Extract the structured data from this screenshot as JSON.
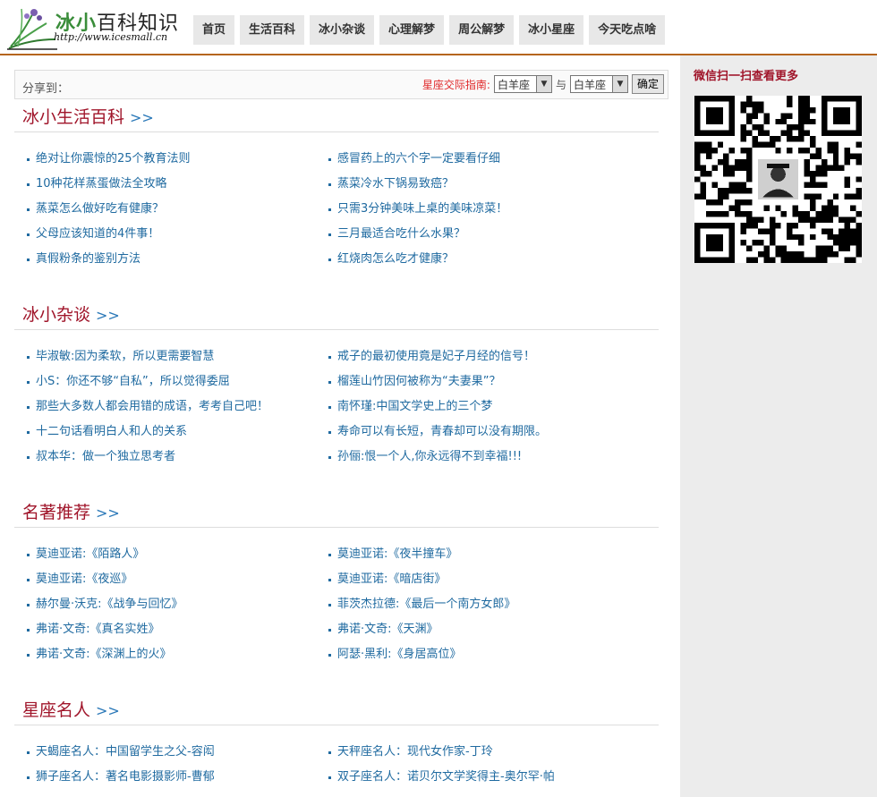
{
  "logo": {
    "name_a": "冰小",
    "name_b": "百科知识",
    "url": "http://www.icesmall.cn"
  },
  "nav": [
    "首页",
    "生活百科",
    "冰小杂谈",
    "心理解梦",
    "周公解梦",
    "冰小星座",
    "今天吃点啥"
  ],
  "share": {
    "label": "分享到：",
    "guide_label": "星座交际指南:",
    "select_a": "白羊座",
    "with": "与",
    "select_b": "白羊座",
    "confirm": "确定"
  },
  "sections": [
    {
      "title": "冰小生活百科",
      "more": ">>",
      "left": [
        "绝对让你震惊的25个教育法则",
        "10种花样蒸蛋做法全攻略",
        "蒸菜怎么做好吃有健康？",
        "父母应该知道的4件事！",
        "真假粉条的鉴别方法"
      ],
      "right": [
        "感冒药上的六个字一定要看仔细",
        "蒸菜冷水下锅易致癌？",
        "只需3分钟美味上桌的美味凉菜！",
        "三月最适合吃什么水果？",
        "红烧肉怎么吃才健康？"
      ]
    },
    {
      "title": "冰小杂谈",
      "more": ">>",
      "left": [
        "毕淑敏:因为柔软，所以更需要智慧",
        "小S：你还不够“自私”，所以觉得委屈",
        "那些大多数人都会用错的成语，考考自己吧！",
        "十二句话看明白人和人的关系",
        "叔本华：做一个独立思考者"
      ],
      "right": [
        "戒子的最初使用竟是妃子月经的信号！",
        "榴莲山竹因何被称为“夫妻果”？",
        "南怀瑾:中国文学史上的三个梦",
        "寿命可以有长短，青春却可以没有期限。",
        "孙俪:恨一个人,你永远得不到幸福!!!"
      ]
    },
    {
      "title": "名著推荐",
      "more": ">>",
      "left": [
        "莫迪亚诺:《陌路人》",
        "莫迪亚诺:《夜巡》",
        "赫尔曼·沃克:《战争与回忆》",
        "弗诺·文奇:《真名实姓》",
        "弗诺·文奇:《深渊上的火》"
      ],
      "right": [
        "莫迪亚诺:《夜半撞车》",
        "莫迪亚诺:《暗店街》",
        "菲茨杰拉德:《最后一个南方女郎》",
        "弗诺·文奇:《天渊》",
        "阿瑟·黑利:《身居高位》"
      ]
    },
    {
      "title": "星座名人",
      "more": ">>",
      "left": [
        "天蝎座名人：中国留学生之父-容闳",
        "狮子座名人：著名电影摄影师-曹郁"
      ],
      "right": [
        "天秤座名人：现代女作家-丁玲",
        "双子座名人：诺贝尔文学奖得主-奥尔罕·帕"
      ]
    }
  ],
  "sidebar": {
    "title": "微信扫一扫查看更多",
    "qr_icon": "qr-code-icon"
  },
  "colors": {
    "accent": "#a0152a",
    "link": "#1f6aa0",
    "header_border": "#b5651d"
  }
}
